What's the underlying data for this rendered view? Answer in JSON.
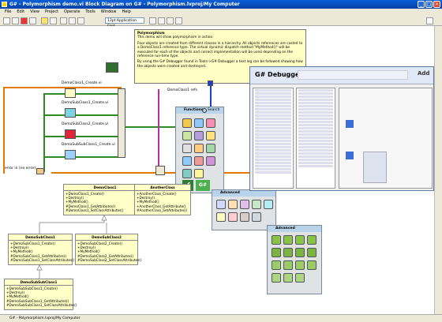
{
  "window": {
    "title": "G# - Polymorphism demo.vi Block Diagram on G# - Polymorphism.lvproj/My Computer"
  },
  "menu": [
    "File",
    "Edit",
    "View",
    "Project",
    "Operate",
    "Tools",
    "Window",
    "Help"
  ],
  "toolbar": {
    "font": "13pt Application Font"
  },
  "note": {
    "title": "Polymorphism",
    "line1": "This demo will show polymorphism in action.",
    "line2": "Four objects are created from different classes in a hierarchy. All objects references are casted to a DemoClass1 reference type. The virtual dynamic dispatch method \"MyMethod()\" will be executed for each of the objects and correct implementation will be used depending on the reference run-time type.",
    "line3": "By using the G# Debugger found in Tools->G# Debugger a text log can be followed showing how the objects were created and destroyed."
  },
  "diagram": {
    "nodes": [
      "DemoClass1_Create.vi",
      "DemoSubClass1_Create.vi",
      "DemoSubClass2_Create.vi",
      "DemoSubSubClass1_Create.vi"
    ],
    "refs_label": "DemoClass1 refs",
    "error_label": "error in (no error)"
  },
  "functions_palette": {
    "title": "Functions",
    "search": "Search",
    "button": "G#"
  },
  "adv_palette1": {
    "title": "Advanced"
  },
  "adv_palette2": {
    "title": "Advanced"
  },
  "debugger": {
    "title": "G# Debugger",
    "brand": "Add"
  },
  "classes": [
    {
      "name": "DemoClass1",
      "methods": [
        "+DemoClass1_Create()",
        "+Destroy()",
        "+MyMethod()",
        "#DemoClass1_GetAttributes()",
        "#DemoClass1_SetClassAttributes()"
      ]
    },
    {
      "name": "AnotherClass",
      "methods": [
        "+AnotherClass_Create()",
        "+Destroy()",
        "+MyMethod()",
        "+AnotherClass_GetAttribute()",
        "#AnotherClass_SetAttributes()"
      ]
    },
    {
      "name": "DemoSubClass1",
      "methods": [
        "+DemoSubClass1_Create()",
        "+Destroy()",
        "+MyMethod()",
        "#DemoSubClass1_GetAttributes()",
        "#DemoSubClass1_SetClassAttributes()"
      ]
    },
    {
      "name": "DemoSubClass2",
      "methods": [
        "+DemoSubClass2_Create()",
        "+Destroy()",
        "+MyMethod()",
        "#DemoSubClass2_GetAttributes()",
        "#DemoSubClass2_SetClassAttributes()"
      ]
    },
    {
      "name": "DemoSubSubClass1",
      "methods": [
        "+DemoSubSubClass1_Create()",
        "+Destroy()",
        "+MyMethod()",
        "#DemoSubSubClass1_GetAttributes()",
        "#DemoSubSubClass1_SetClassAttributes()"
      ]
    }
  ],
  "status": {
    "text": "G# - Polymorphism.lvproj/My Computer"
  },
  "colors": {
    "wire_orange": "#e07b00",
    "wire_green": "#2e8a22",
    "wire_blue": "#1f3fc8",
    "note_bg": "#ffffc4"
  }
}
